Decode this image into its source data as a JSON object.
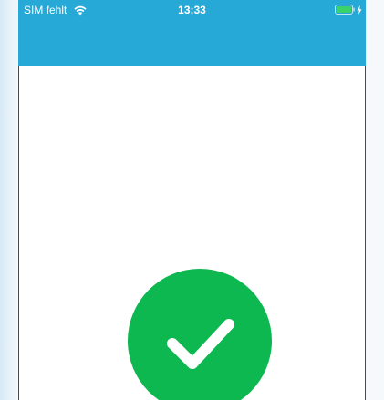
{
  "status_bar": {
    "carrier": "SIM fehlt",
    "time": "13:33",
    "wifi_icon": "wifi-icon",
    "battery_icon": "battery-icon",
    "charging_icon": "charging-bolt-icon",
    "battery_color": "#3ad36b"
  },
  "header": {
    "background": "#27a9d8"
  },
  "success": {
    "icon": "checkmark-icon",
    "color": "#0cb84f"
  }
}
